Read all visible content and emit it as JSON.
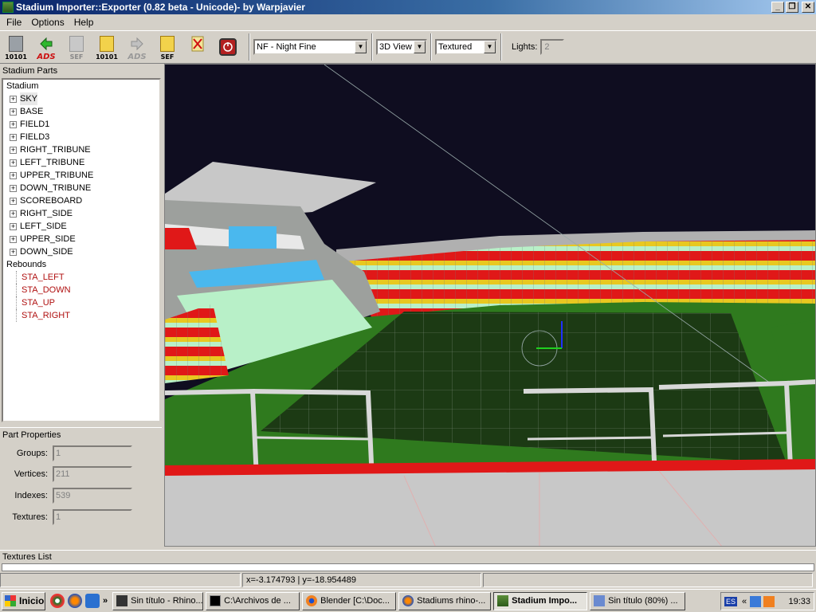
{
  "window": {
    "title": "Stadium Importer::Exporter (0.82 beta - Unicode)- by Warpjavier",
    "minimize": "_",
    "restore": "❐",
    "close": "✕"
  },
  "menu": {
    "items": [
      "File",
      "Options",
      "Help"
    ]
  },
  "toolbar": {
    "buttons": [
      {
        "label": "10101"
      },
      {
        "label": "ADS"
      },
      {
        "label": "SEF"
      },
      {
        "label": "10101"
      },
      {
        "label": "ADS"
      },
      {
        "label": "SEF"
      }
    ],
    "weather_select": "NF - Night Fine",
    "view_select": "3D View",
    "render_select": "Textured",
    "lights_label": "Lights:",
    "lights_value": "2"
  },
  "left": {
    "stadium_parts_header": "Stadium Parts",
    "tree_root": "Stadium",
    "parts": [
      "SKY",
      "BASE",
      "FIELD1",
      "FIELD3",
      "RIGHT_TRIBUNE",
      "LEFT_TRIBUNE",
      "UPPER_TRIBUNE",
      "DOWN_TRIBUNE",
      "SCOREBOARD",
      "RIGHT_SIDE",
      "LEFT_SIDE",
      "UPPER_SIDE",
      "DOWN_SIDE"
    ],
    "rebounds_root": "Rebounds",
    "rebounds": [
      "STA_LEFT",
      "STA_DOWN",
      "STA_UP",
      "STA_RIGHT"
    ],
    "expander_symbol": "+"
  },
  "properties": {
    "header": "Part Properties",
    "groups_label": "Groups:",
    "groups_value": "1",
    "vertices_label": "Vertices:",
    "vertices_value": "211",
    "indexes_label": "Indexes:",
    "indexes_value": "539",
    "textures_label": "Textures:",
    "textures_value": "1"
  },
  "textures_list": {
    "header": "Textures List"
  },
  "status": {
    "coords": "x=-3.174793 | y=-18.954489"
  },
  "taskbar": {
    "start": "Inicio",
    "more": "»",
    "tasks": [
      {
        "label": "Sin título - Rhino..."
      },
      {
        "label": "C:\\Archivos de ..."
      },
      {
        "label": "Blender [C:\\Doc..."
      },
      {
        "label": "Stadiums rhino-..."
      },
      {
        "label": "Stadium Impo..."
      },
      {
        "label": "Sin título (80%) ..."
      }
    ],
    "lang": "ES",
    "tray_more": "«",
    "clock": "19:33"
  },
  "colors": {
    "sky": "#0f0d20",
    "grass": "#2f7a1e",
    "pitch_dark": "#1c3a14",
    "stand_red": "#e01818",
    "stand_yellow": "#e8c820",
    "stand_mint": "#b8f0c8",
    "stand_blue": "#4ab8ee",
    "concrete": "#c8c8c8"
  }
}
